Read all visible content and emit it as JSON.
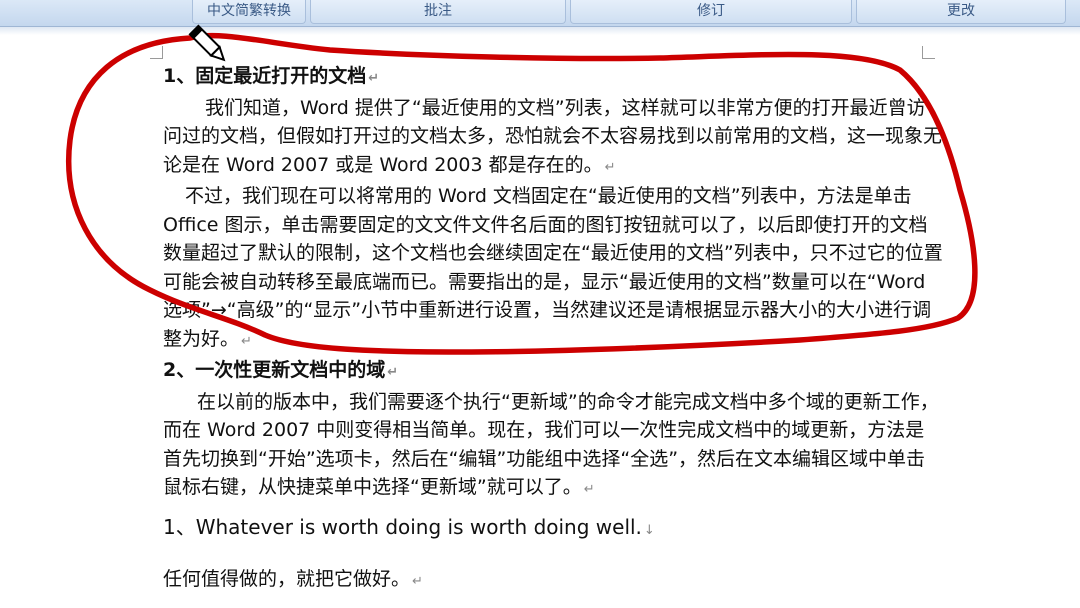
{
  "ribbon": {
    "groups": [
      "中文简繁转换",
      "批注",
      "修订",
      "更改"
    ]
  },
  "document": {
    "heading1": "1、固定最近打开的文档",
    "p1": "我们知道，Word 提供了“最近使用的文档”列表，这样就可以非常方便的打开最近曾访问过的文档，但假如打开过的文档太多，恐怕就会不太容易找到以前常用的文档，这一现象无论是在 Word 2007 或是 Word 2003 都是存在的。",
    "p2": "不过，我们现在可以将常用的 Word 文档固定在“最近使用的文档”列表中，方法是单击 Office 图示，单击需要固定的文文件文件名后面的图钉按钮就可以了，以后即使打开的文档数量超过了默认的限制，这个文档也会继续固定在“最近使用的文档”列表中，只不过它的位置可能会被自动转移至最底端而已。需要指出的是，显示“最近使用的文档”数量可以在“Word 选项”→“高级”的“显示”小节中重新进行设置，当然建议还是请根据显示器大小的大小进行调整为好。",
    "heading2": "2、一次性更新文档中的域",
    "p3": "在以前的版本中，我们需要逐个执行“更新域”的命令才能完成文档中多个域的更新工作，而在 Word 2007 中则变得相当简单。现在，我们可以一次性完成文档中的域更新，方法是首先切换到“开始”选项卡，然后在“编辑”功能组中选择“全选”，然后在文本编辑区域中单击鼠标右键，从快捷菜单中选择“更新域”就可以了。",
    "line_en": "1、Whatever is worth doing is worth doing well.",
    "line_cn": "任何值得做的，就把它做好。",
    "para_mark": "↵",
    "line_mark": "↓"
  },
  "annotation": {
    "ink_color": "#cc0000"
  }
}
